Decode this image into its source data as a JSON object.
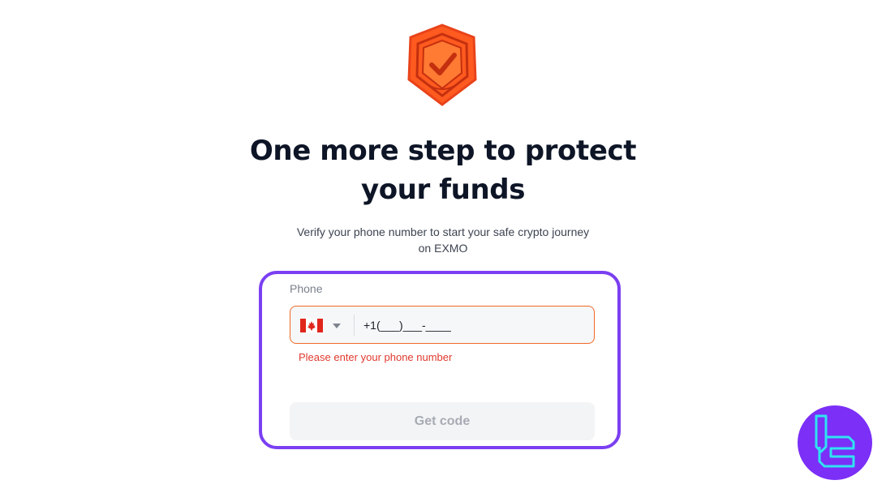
{
  "header": {
    "shield_icon": "shield-check-icon",
    "title_line1": "One more step to protect",
    "title_line2": "your funds",
    "subtitle_line1": "Verify your phone number to start your safe crypto journey",
    "subtitle_line2": "on EXMO"
  },
  "form": {
    "phone_label": "Phone",
    "country_flag_icon": "canada-flag-icon",
    "phone_value": "+1(___)___-____",
    "error_message": "Please enter your phone number",
    "submit_label": "Get code"
  },
  "watermark": {
    "logo_icon": "tradingfinder-logo-icon"
  },
  "colors": {
    "accent_orange": "#f0692a",
    "highlight_purple": "#7b3ff2",
    "error_red": "#e03a2e",
    "title_dark": "#0d1526"
  }
}
